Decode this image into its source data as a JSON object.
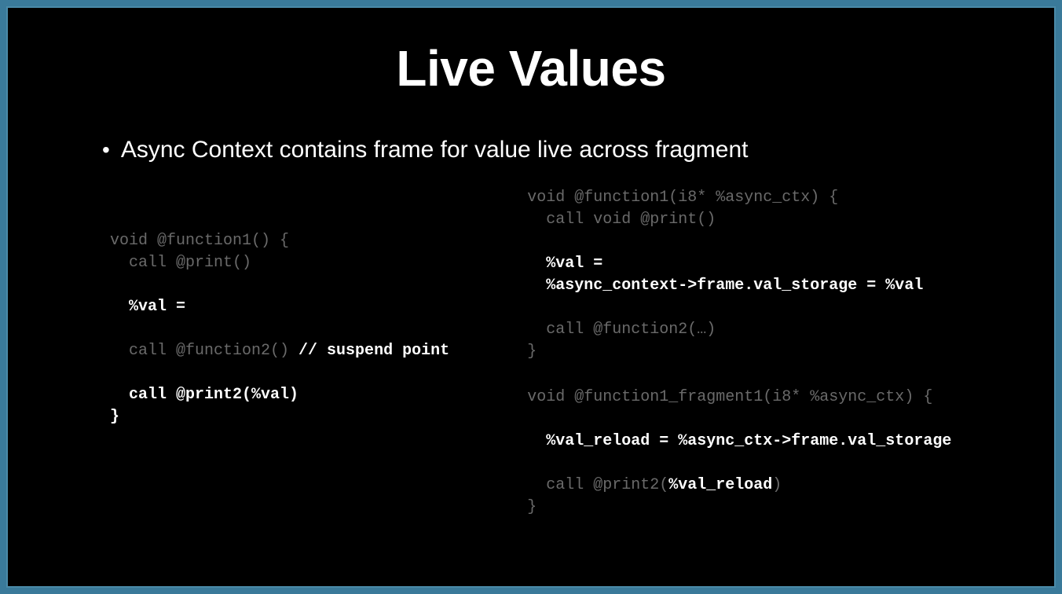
{
  "slide": {
    "title": "Live Values",
    "bullet": "Async Context contains frame for value live across fragment"
  },
  "code_left": {
    "l1": "void @function1() {",
    "l2": "  call @print()",
    "l3": "  %val =",
    "l4a": "  call @function2() ",
    "l4b": "// suspend point",
    "l5": "  call @print2(%val)",
    "l6": "}"
  },
  "code_right_block1": {
    "l1": "void @function1(i8* %async_ctx) {",
    "l2": "  call void @print()",
    "l3": "  %val =",
    "l4": "  %async_context->frame.val_storage = %val",
    "l5": "  call @function2(…)",
    "l6": "}"
  },
  "code_right_block2": {
    "l1": "void @function1_fragment1(i8* %async_ctx) {",
    "l2": "  %val_reload = %async_ctx->frame.val_storage",
    "l3a": "  call @print2(",
    "l3b": "%val_reload",
    "l3c": ")",
    "l4": "}"
  }
}
